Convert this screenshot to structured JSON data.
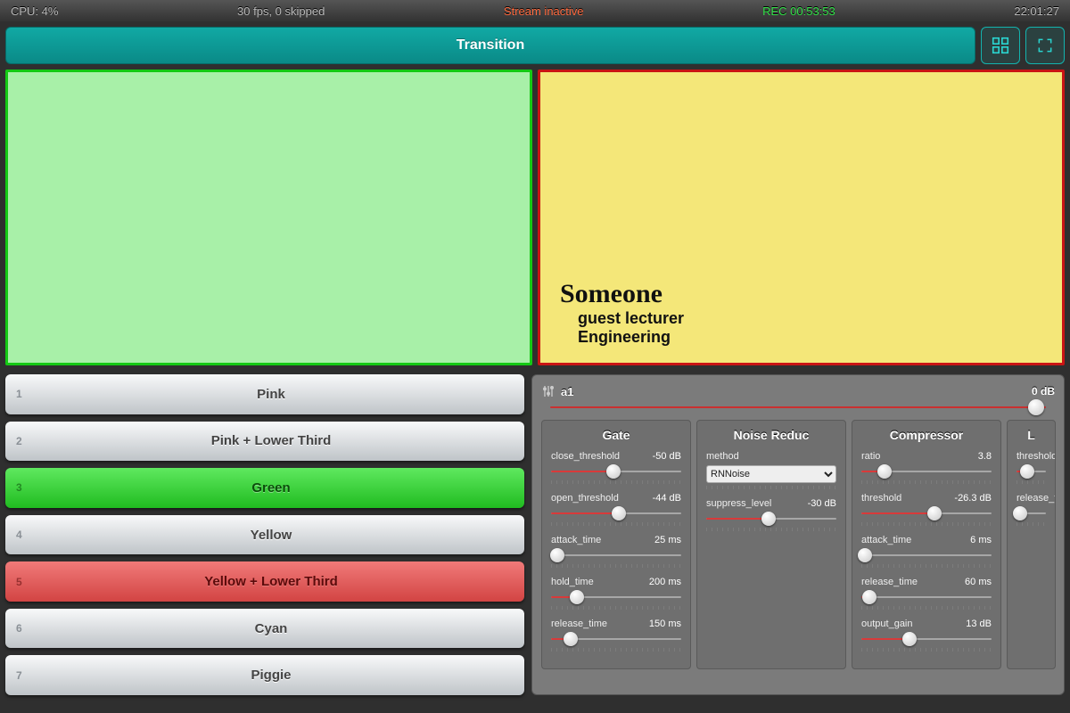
{
  "status": {
    "cpu": "CPU: 4%",
    "fps": "30 fps, 0 skipped",
    "stream": "Stream inactive",
    "rec": "REC 00:53:53",
    "clock": "22:01:27"
  },
  "transition_label": "Transition",
  "preview": {
    "lower_third": {
      "name": "Someone",
      "line1": "guest lecturer",
      "line2": "Engineering"
    }
  },
  "scenes": [
    {
      "num": "1",
      "label": "Pink",
      "state": "gray"
    },
    {
      "num": "2",
      "label": "Pink + Lower Third",
      "state": "gray"
    },
    {
      "num": "3",
      "label": "Green",
      "state": "green"
    },
    {
      "num": "4",
      "label": "Yellow",
      "state": "gray"
    },
    {
      "num": "5",
      "label": "Yellow + Lower Third",
      "state": "red"
    },
    {
      "num": "6",
      "label": "Cyan",
      "state": "gray"
    },
    {
      "num": "7",
      "label": "Piggie",
      "state": "gray"
    }
  ],
  "audio": {
    "name": "a1",
    "db": "0 dB",
    "vol_pos": 0.98,
    "fx": {
      "gate": {
        "title": "Gate",
        "params": [
          {
            "label": "close_threshold",
            "value": "-50 dB",
            "pos": 0.48
          },
          {
            "label": "open_threshold",
            "value": "-44 dB",
            "pos": 0.52
          },
          {
            "label": "attack_time",
            "value": "25 ms",
            "pos": 0.05
          },
          {
            "label": "hold_time",
            "value": "200 ms",
            "pos": 0.2
          },
          {
            "label": "release_time",
            "value": "150 ms",
            "pos": 0.15
          }
        ]
      },
      "nr": {
        "title": "Noise Reduc",
        "method": {
          "label": "method",
          "selected": "RNNoise"
        },
        "params": [
          {
            "label": "suppress_level",
            "value": "-30 dB",
            "pos": 0.48
          }
        ]
      },
      "comp": {
        "title": "Compressor",
        "params": [
          {
            "label": "ratio",
            "value": "3.8",
            "pos": 0.18
          },
          {
            "label": "threshold",
            "value": "-26.3 dB",
            "pos": 0.56
          },
          {
            "label": "attack_time",
            "value": "6 ms",
            "pos": 0.03
          },
          {
            "label": "release_time",
            "value": "60 ms",
            "pos": 0.06
          },
          {
            "label": "output_gain",
            "value": "13 dB",
            "pos": 0.37
          }
        ]
      },
      "lim": {
        "title": "L",
        "params": [
          {
            "label": "threshold",
            "value": "",
            "pos": 0.35
          },
          {
            "label": "release_tim",
            "value": "",
            "pos": 0.12
          }
        ]
      }
    }
  }
}
